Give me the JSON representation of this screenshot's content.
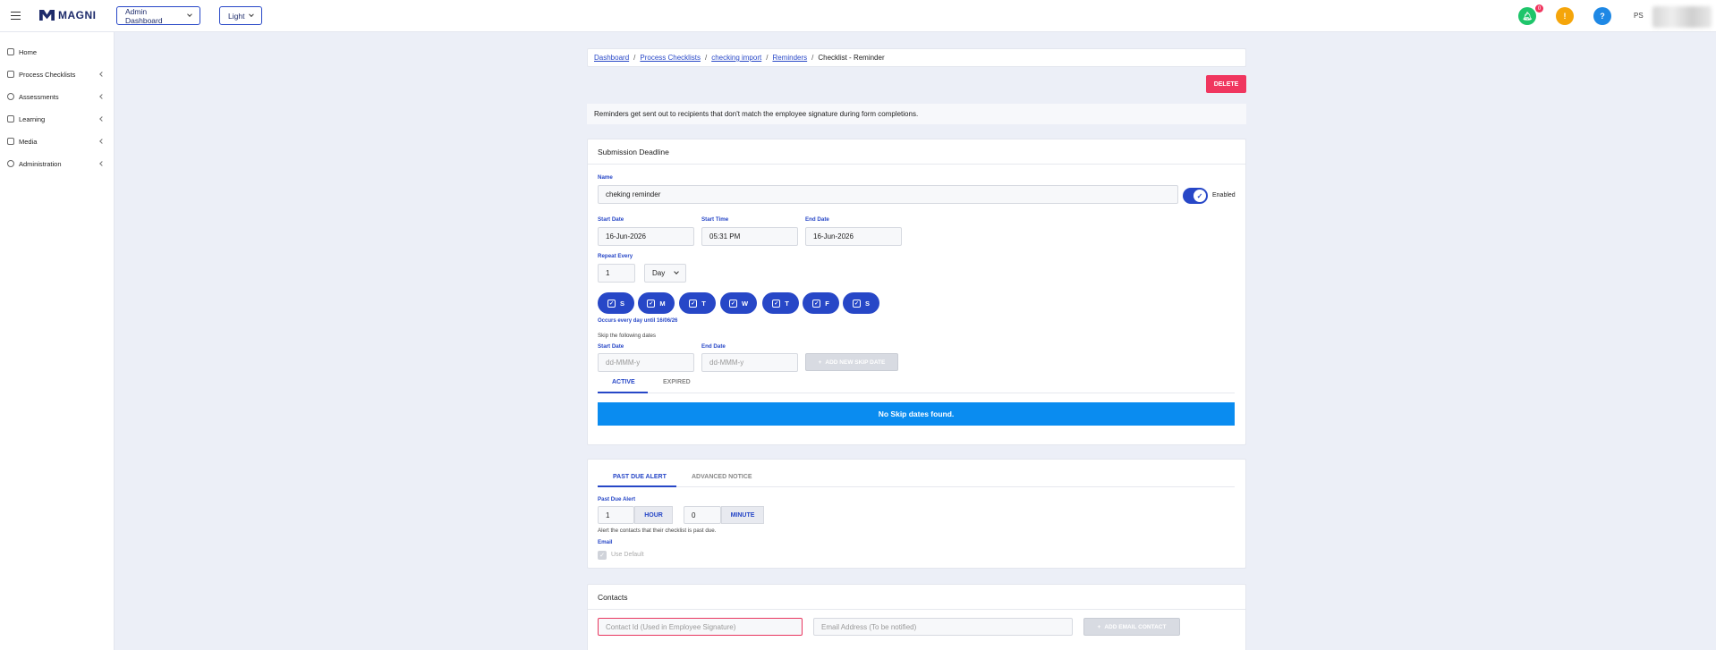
{
  "header": {
    "brand": "MAGNI",
    "dashboard_select": "Admin Dashboard",
    "theme_select": "Light",
    "notification_count": "0",
    "help_label": "?",
    "user_initials": "PS"
  },
  "sidebar": {
    "items": [
      {
        "label": "Home"
      },
      {
        "label": "Process Checklists"
      },
      {
        "label": "Assessments"
      },
      {
        "label": "Learning"
      },
      {
        "label": "Media"
      },
      {
        "label": "Administration"
      }
    ]
  },
  "breadcrumb": {
    "items": [
      "Dashboard",
      "Process Checklists",
      "checking import",
      "Reminders"
    ],
    "current": "Checklist - Reminder",
    "separator": "/"
  },
  "actions": {
    "delete_label": "DELETE"
  },
  "info_text": "Reminders get sent out to recipients that don't match the employee signature during form completions.",
  "submission": {
    "title": "Submission Deadline",
    "name_label": "Name",
    "name_value": "cheking reminder",
    "enabled_label": "Enabled",
    "start_date_label": "Start Date",
    "start_date_value": "16-Jun-2026",
    "start_time_label": "Start Time",
    "start_time_value": "05:31 PM",
    "end_date_label": "End Date",
    "end_date_value": "16-Jun-2026",
    "repeat_label": "Repeat Every",
    "repeat_value": "1",
    "repeat_unit": "Day",
    "days": [
      "S",
      "M",
      "T",
      "W",
      "T",
      "F",
      "S"
    ],
    "occurs_text": "Occurs every day until 16/06/26",
    "skip_text": "Skip the following dates",
    "skip_start_label": "Start Date",
    "skip_start_placeholder": "dd-MMM-y",
    "skip_end_label": "End Date",
    "skip_end_placeholder": "dd-MMM-y",
    "add_skip_label": "ADD NEW SKIP DATE",
    "tabs": [
      "ACTIVE",
      "EXPIRED"
    ],
    "no_skip_text": "No Skip dates found."
  },
  "alerts": {
    "tabs": [
      "PAST DUE ALERT",
      "ADVANCED NOTICE"
    ],
    "past_due_label": "Past Due Alert",
    "hour_value": "1",
    "hour_unit": "HOUR",
    "minute_value": "0",
    "minute_unit": "MINUTE",
    "alert_note": "Alert the contacts that their checklist is past due.",
    "email_label": "Email",
    "use_default_label": "Use Default"
  },
  "contacts": {
    "title": "Contacts",
    "contact_id_placeholder": "Contact Id (Used in Employee Signature)",
    "email_placeholder": "Email Address (To be notified)",
    "add_label": "ADD EMAIL CONTACT"
  },
  "colors": {
    "primary": "#2747c7",
    "danger": "#f0365f",
    "info_bar": "#0a8cf0",
    "bell_green": "#1ec56a",
    "amber": "#f5a50a",
    "help_blue": "#1e88e5"
  }
}
